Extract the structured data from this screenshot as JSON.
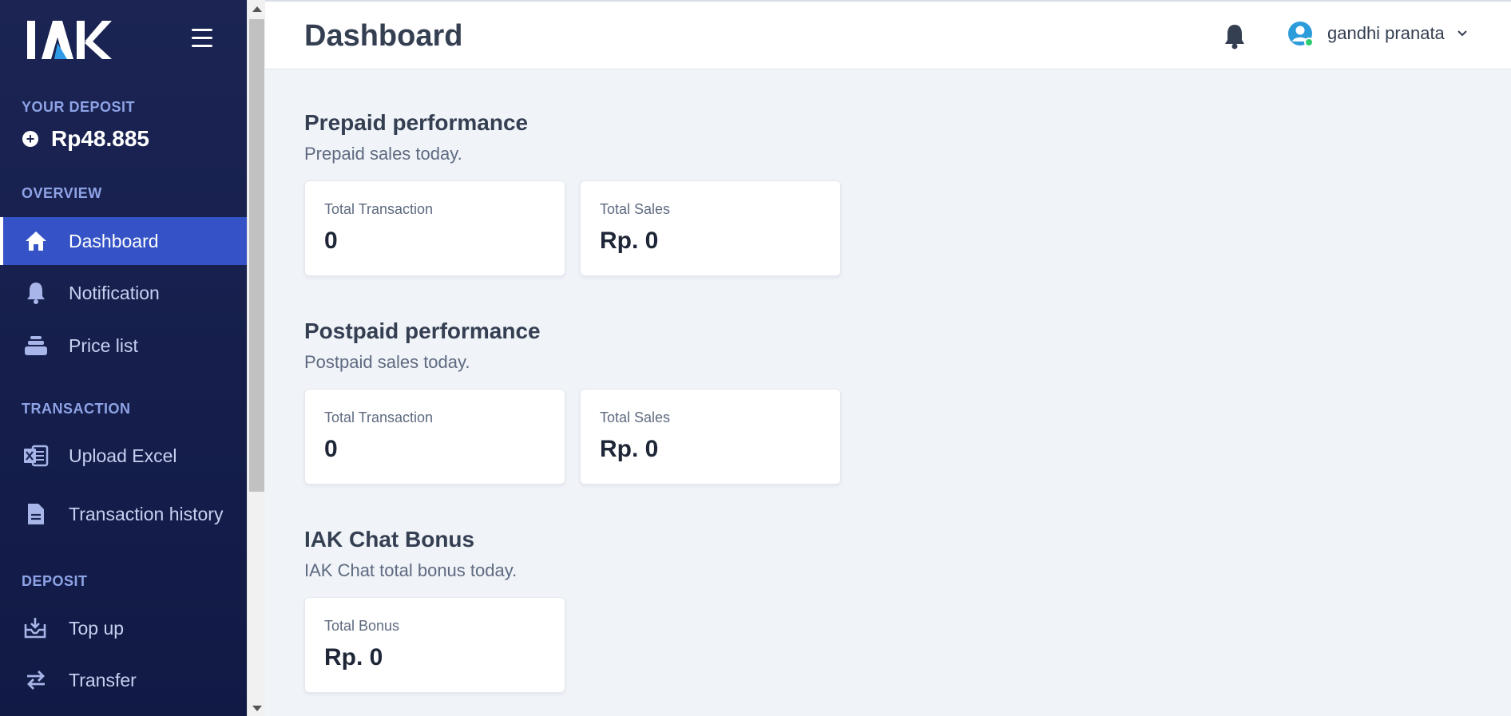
{
  "brand": {
    "logo_text": "IAK"
  },
  "sidebar": {
    "deposit_label": "YOUR DEPOSIT",
    "deposit_amount": "Rp48.885",
    "sections": {
      "overview": "OVERVIEW",
      "transaction": "TRANSACTION",
      "deposit": "DEPOSIT"
    },
    "items": [
      {
        "label": "Dashboard",
        "icon": "home-icon",
        "active": true
      },
      {
        "label": "Notification",
        "icon": "bell-icon",
        "active": false
      },
      {
        "label": "Price list",
        "icon": "stack-icon",
        "active": false
      },
      {
        "label": "Upload Excel",
        "icon": "excel-icon",
        "active": false
      },
      {
        "label": "Transaction history",
        "icon": "document-icon",
        "active": false
      },
      {
        "label": "Top up",
        "icon": "topup-icon",
        "active": false
      },
      {
        "label": "Transfer",
        "icon": "transfer-icon",
        "active": false
      }
    ]
  },
  "header": {
    "title": "Dashboard",
    "user_name": "gandhi pranata"
  },
  "prepaid": {
    "title": "Prepaid performance",
    "subtitle": "Prepaid sales today.",
    "cards": [
      {
        "label": "Total Transaction",
        "value": "0"
      },
      {
        "label": "Total Sales",
        "value": "Rp. 0"
      }
    ]
  },
  "postpaid": {
    "title": "Postpaid performance",
    "subtitle": "Postpaid sales today.",
    "cards": [
      {
        "label": "Total Transaction",
        "value": "0"
      },
      {
        "label": "Total Sales",
        "value": "Rp. 0"
      }
    ]
  },
  "chat_bonus": {
    "title": "IAK Chat Bonus",
    "subtitle": "IAK Chat total bonus today.",
    "cards": [
      {
        "label": "Total Bonus",
        "value": "Rp. 0"
      }
    ]
  },
  "colors": {
    "sidebar_bg": "#1b2453",
    "active_item": "#3553c6",
    "section_label": "#8ea3e6",
    "content_bg": "#f0f3f8",
    "online_dot": "#2ecc71",
    "avatar": "#2d9cdb"
  }
}
